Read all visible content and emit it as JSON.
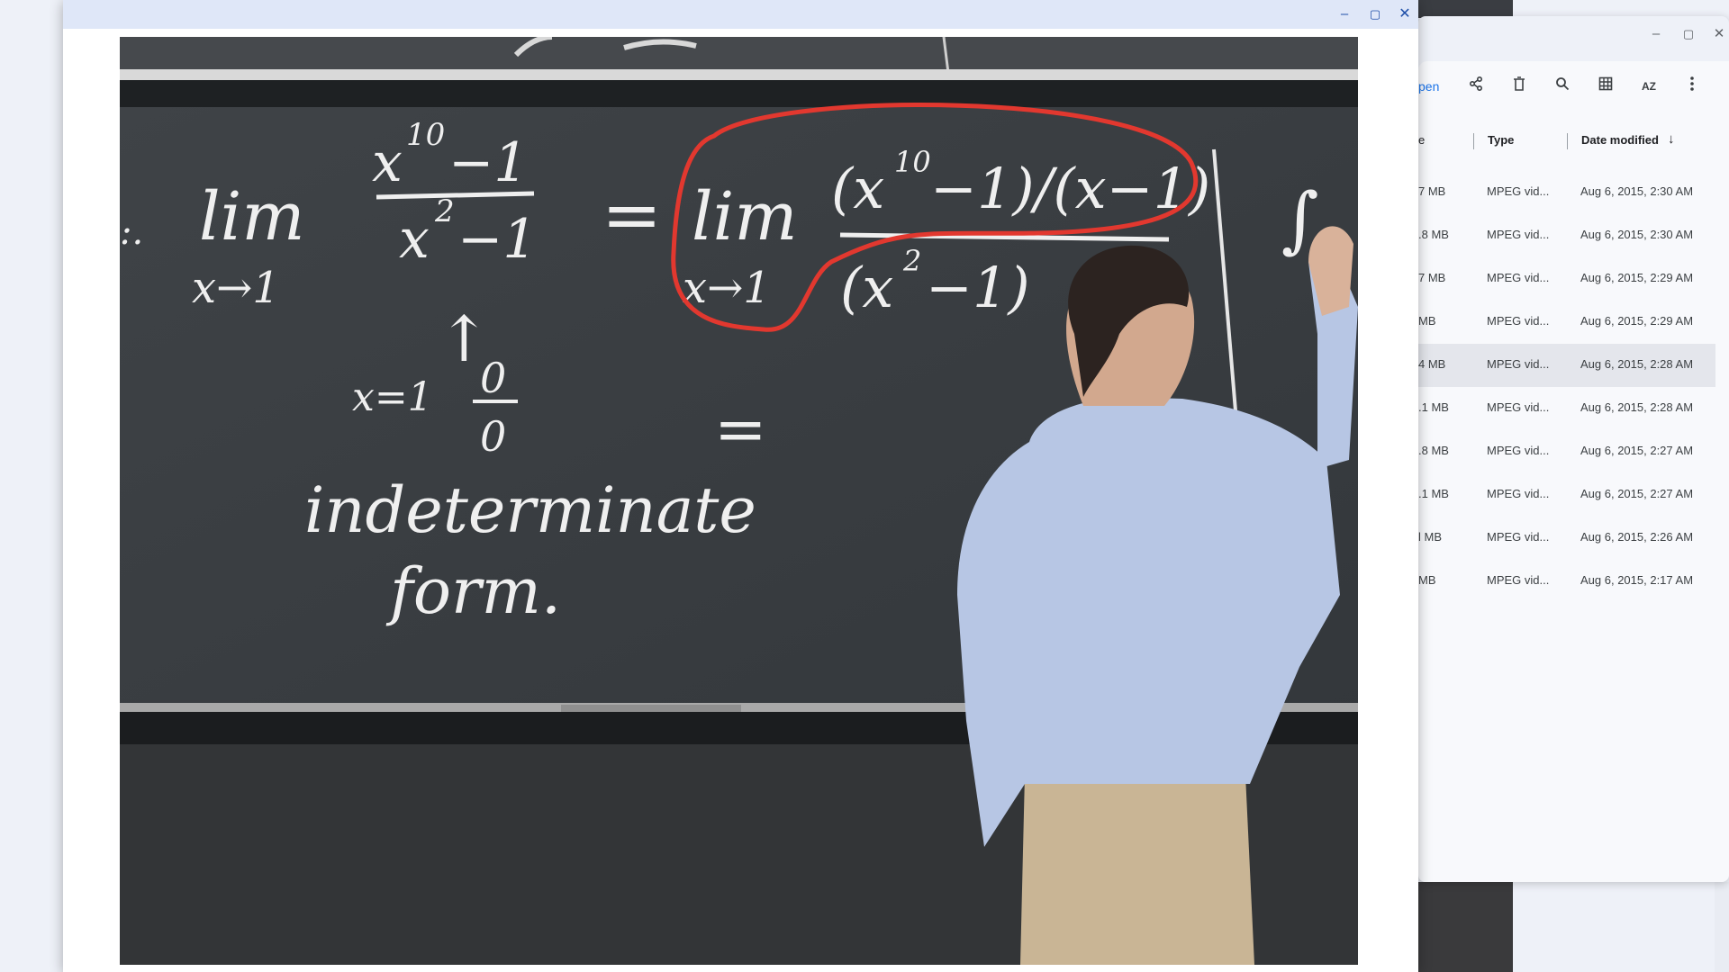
{
  "video_window": {
    "controls": {
      "minimize": "–",
      "maximize": "▢",
      "close": "✕"
    }
  },
  "files_window": {
    "controls": {
      "minimize": "–",
      "maximize": "▢",
      "close": "✕"
    },
    "toolbar": {
      "open_label": "pen",
      "icons": [
        "share-icon",
        "delete-icon",
        "search-icon",
        "grid-view-icon",
        "sort-az-icon",
        "more-vert-icon"
      ]
    },
    "header": {
      "size": "e",
      "type": "Type",
      "date": "Date modified",
      "sort_arrow": "↓"
    },
    "rows": [
      {
        "size": "7 MB",
        "type": "MPEG vid...",
        "date": "Aug 6, 2015, 2:30 AM"
      },
      {
        "size": ".8 MB",
        "type": "MPEG vid...",
        "date": "Aug 6, 2015, 2:30 AM"
      },
      {
        "size": "7 MB",
        "type": "MPEG vid...",
        "date": "Aug 6, 2015, 2:29 AM"
      },
      {
        "size": " MB",
        "type": "MPEG vid...",
        "date": "Aug 6, 2015, 2:29 AM"
      },
      {
        "size": "4 MB",
        "type": "MPEG vid...",
        "date": "Aug 6, 2015, 2:28 AM"
      },
      {
        "size": ".1 MB",
        "type": "MPEG vid...",
        "date": "Aug 6, 2015, 2:28 AM"
      },
      {
        "size": ".8 MB",
        "type": "MPEG vid...",
        "date": "Aug 6, 2015, 2:27 AM"
      },
      {
        "size": ".1 MB",
        "type": "MPEG vid...",
        "date": "Aug 6, 2015, 2:27 AM"
      },
      {
        "size": "l MB",
        "type": "MPEG vid...",
        "date": "Aug 6, 2015, 2:26 AM"
      },
      {
        "size": "MB",
        "type": "MPEG vid...",
        "date": "Aug 6, 2015, 2:17 AM"
      }
    ],
    "selected_row": 4
  },
  "board": {
    "lim": "lim",
    "lim_sub": "x→1",
    "num1": "x",
    "num1_exp": "10",
    "num1_rest": "−1",
    "den1": "x",
    "den1_exp": "2",
    "den1_rest": "−1",
    "equals": "=",
    "num2_a": "(x",
    "num2_exp": "10",
    "num2_b": "−1)/(x−1)",
    "den2_a": "(x",
    "den2_exp": "2",
    "den2_b": "−1)",
    "den2_tail": "/)",
    "arrow": "↑",
    "x_eq_1": "x=1",
    "zero_top": "0",
    "zero_bot": "0",
    "equals2": "=",
    "indeterminate": "indeterminate",
    "form": "form.",
    "left_mark": ":.",
    "right_mark": "∫"
  }
}
